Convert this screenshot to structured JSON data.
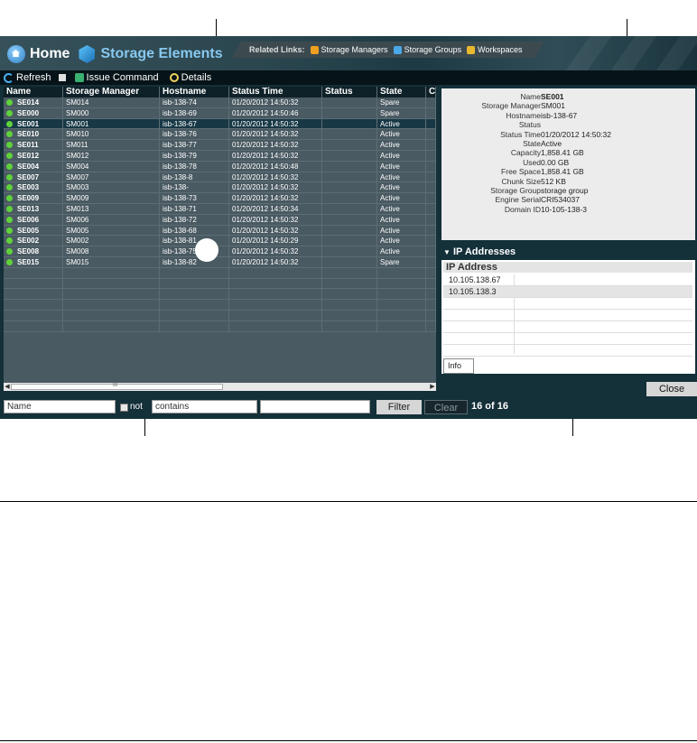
{
  "header": {
    "home_label": "Home",
    "section_label": "Storage Elements",
    "related_links_label": "Related Links:",
    "related_links": [
      {
        "label": "Storage Managers",
        "icon": "storage-manager-icon",
        "color": "#f0a020"
      },
      {
        "label": "Storage Groups",
        "icon": "storage-groups-icon",
        "color": "#4aa8e8"
      },
      {
        "label": "Workspaces",
        "icon": "workspaces-icon",
        "color": "#e8b830"
      }
    ]
  },
  "toolbar": {
    "refresh": "Refresh",
    "issue_command": "Issue Command",
    "details": "Details"
  },
  "grid": {
    "columns": [
      "Name",
      "Storage Manager",
      "Hostname",
      "Status Time",
      "Status",
      "State",
      "C"
    ],
    "rows": [
      {
        "name": "SE014",
        "sm": "SM014",
        "host": "isb-138-74",
        "time": "01/20/2012 14:50:32",
        "status": "",
        "state": "Spare"
      },
      {
        "name": "SE000",
        "sm": "SM000",
        "host": "isb-138-69",
        "time": "01/20/2012 14:50:46",
        "status": "",
        "state": "Spare"
      },
      {
        "name": "SE001",
        "sm": "SM001",
        "host": "isb-138-67",
        "time": "01/20/2012 14:50:32",
        "status": "",
        "state": "Active"
      },
      {
        "name": "SE010",
        "sm": "SM010",
        "host": "isb-138-76",
        "time": "01/20/2012 14:50:32",
        "status": "",
        "state": "Active"
      },
      {
        "name": "SE011",
        "sm": "SM011",
        "host": "isb-138-77",
        "time": "01/20/2012 14:50:32",
        "status": "",
        "state": "Active"
      },
      {
        "name": "SE012",
        "sm": "SM012",
        "host": "isb-138-79",
        "time": "01/20/2012 14:50:32",
        "status": "",
        "state": "Active"
      },
      {
        "name": "SE004",
        "sm": "SM004",
        "host": "isb-138-78",
        "time": "01/20/2012 14:50:48",
        "status": "",
        "state": "Active"
      },
      {
        "name": "SE007",
        "sm": "SM007",
        "host": "isb-138-8",
        "time": "01/20/2012 14:50:32",
        "status": "",
        "state": "Active"
      },
      {
        "name": "SE003",
        "sm": "SM003",
        "host": "isb-138-",
        "time": "01/20/2012 14:50:32",
        "status": "",
        "state": "Active"
      },
      {
        "name": "SE009",
        "sm": "SM009",
        "host": "isb-138-73",
        "time": "01/20/2012 14:50:32",
        "status": "",
        "state": "Active"
      },
      {
        "name": "SE013",
        "sm": "SM013",
        "host": "isb-138-71",
        "time": "01/20/2012 14:50:34",
        "status": "",
        "state": "Active"
      },
      {
        "name": "SE006",
        "sm": "SM006",
        "host": "isb-138-72",
        "time": "01/20/2012 14:50:32",
        "status": "",
        "state": "Active"
      },
      {
        "name": "SE005",
        "sm": "SM005",
        "host": "isb-138-68",
        "time": "01/20/2012 14:50:32",
        "status": "",
        "state": "Active"
      },
      {
        "name": "SE002",
        "sm": "SM002",
        "host": "isb-138-81",
        "time": "01/20/2012 14:50:29",
        "status": "",
        "state": "Active"
      },
      {
        "name": "SE008",
        "sm": "SM008",
        "host": "isb-138-75",
        "time": "01/20/2012 14:50:32",
        "status": "",
        "state": "Active"
      },
      {
        "name": "SE015",
        "sm": "SM015",
        "host": "isb-138-82",
        "time": "01/20/2012 14:50:32",
        "status": "",
        "state": "Spare"
      }
    ],
    "selected_index": 2,
    "scroll_mark": "III"
  },
  "filter": {
    "field": "Name",
    "not_label": "not",
    "operator": "contains",
    "value": "",
    "filter_label": "Filter",
    "clear_label": "Clear",
    "count": "16 of 16"
  },
  "detail": {
    "fields": [
      {
        "label": "Name",
        "value": "SE001"
      },
      {
        "label": "Storage Manager",
        "value": "SM001"
      },
      {
        "label": "Hostname",
        "value": "isb-138-67"
      },
      {
        "label": "Status",
        "value": ""
      },
      {
        "label": "Status Time",
        "value": "01/20/2012 14:50:32"
      },
      {
        "label": "State",
        "value": "Active"
      },
      {
        "label": "Capacity",
        "value": "1,858.41 GB"
      },
      {
        "label": "Used",
        "value": "0.00 GB"
      },
      {
        "label": "Free Space",
        "value": "1,858.41 GB"
      },
      {
        "label": "Chunk Size",
        "value": "512 KB"
      },
      {
        "label": "Storage Group",
        "value": "storage group"
      },
      {
        "label": "Engine Serial",
        "value": "CRI534037"
      },
      {
        "label": "Domain ID",
        "value": "10-105-138-3"
      }
    ]
  },
  "ip": {
    "title": "IP Addresses",
    "column": "IP Address",
    "rows": [
      "10.105.138.67",
      "10.105.138.3"
    ],
    "info_label": "Info"
  },
  "close_label": "Close"
}
